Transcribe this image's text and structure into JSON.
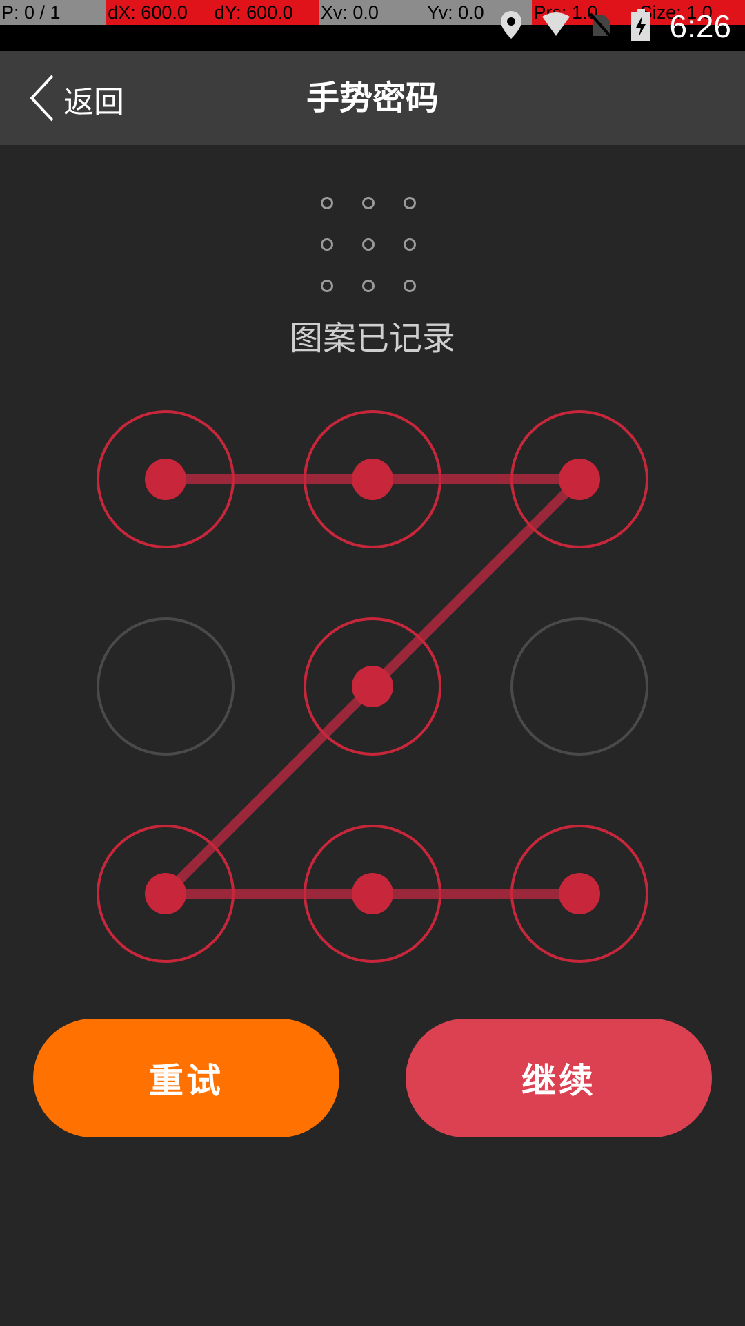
{
  "debug": {
    "cells": [
      {
        "text": "P: 0 / 1",
        "color": "#8c8c8c"
      },
      {
        "text": "dX: 600.0",
        "color": "#e0121a"
      },
      {
        "text": "dY: 600.0",
        "color": "#e0121a"
      },
      {
        "text": "Xv: 0.0",
        "color": "#8c8c8c"
      },
      {
        "text": "Yv: 0.0",
        "color": "#8c8c8c"
      },
      {
        "text": "Prs: 1.0",
        "color": "#e0121a"
      },
      {
        "text": "Size: 1.0",
        "color": "#e0121a"
      }
    ]
  },
  "status_bar": {
    "time": "6:26",
    "icons": [
      "location-icon",
      "wifi-icon",
      "no-sim-icon",
      "battery-charging-icon"
    ]
  },
  "header": {
    "back_label": "返回",
    "title": "手势密码"
  },
  "preview": {
    "dots": [
      false,
      false,
      false,
      false,
      false,
      false,
      false,
      false,
      false
    ]
  },
  "status_message": "图案已记录",
  "pattern": {
    "selected": [
      true,
      true,
      true,
      false,
      true,
      false,
      true,
      true,
      true
    ],
    "path": [
      0,
      1,
      2,
      4,
      6,
      7,
      8
    ],
    "colors": {
      "selected": "#c8273b",
      "unselected": "#4a4a4a",
      "line": "#b0293e"
    }
  },
  "buttons": {
    "retry": "重试",
    "continue": "继续"
  },
  "colors": {
    "background": "#262626",
    "header": "#3d3d3d",
    "retry": "#ff7100",
    "continue": "#dc4151"
  }
}
